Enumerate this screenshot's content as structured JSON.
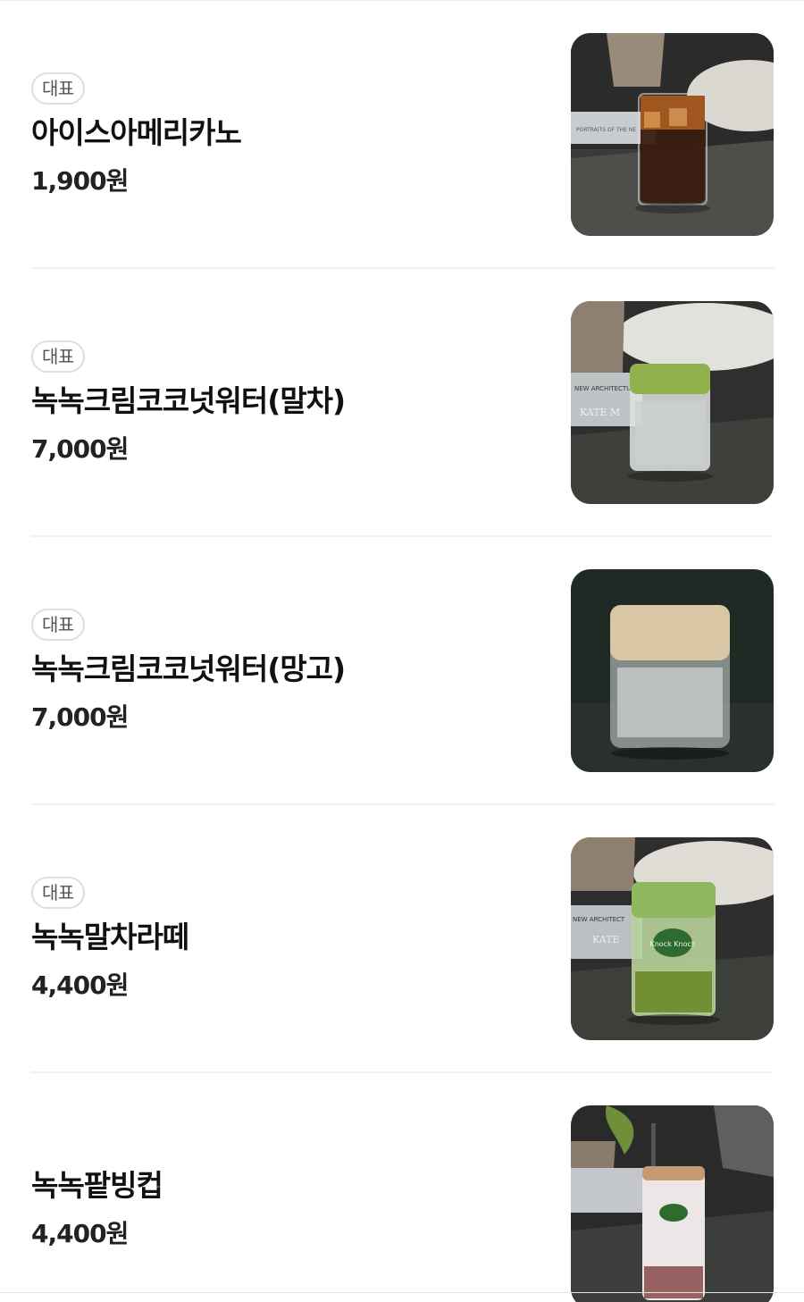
{
  "menu": {
    "items": [
      {
        "badge": "대표",
        "name": "아이스아메리카노",
        "price": "1,900원"
      },
      {
        "badge": "대표",
        "name": "녹녹크림코코넛워터(말차)",
        "price": "7,000원"
      },
      {
        "badge": "대표",
        "name": "녹녹크림코코넛워터(망고)",
        "price": "7,000원"
      },
      {
        "badge": "대표",
        "name": "녹녹말차라떼",
        "price": "4,400원"
      },
      {
        "name": "녹녹팥빙컵",
        "price": "4,400원"
      }
    ]
  },
  "photo_text": {
    "book_1": "PORTRAITS OF THE NE",
    "book_2_top": "NEW ARCHITECTURE",
    "book_2_bottom": "KATE M",
    "book_4_top": "NEW ARCHITECT",
    "book_4_bottom": "KATE",
    "cup_logo": "Knock Knock"
  }
}
